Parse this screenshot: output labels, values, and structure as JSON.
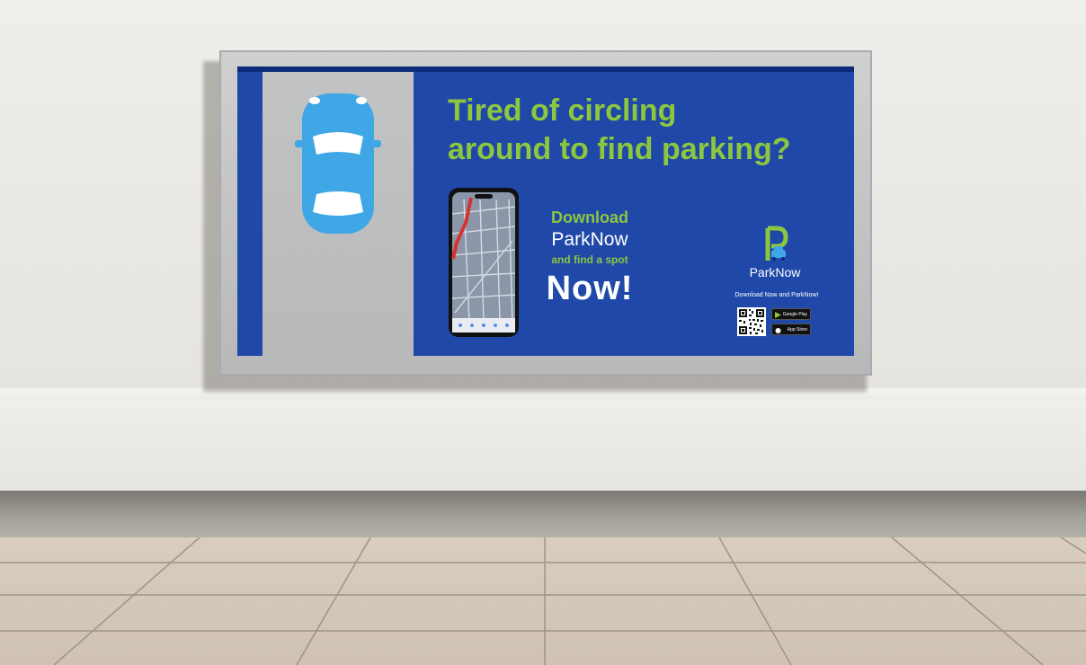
{
  "billboard": {
    "headline_line1": "Tired of circling",
    "headline_line2": "around to find parking?",
    "cta_download": "Download",
    "cta_brand": "ParkNow",
    "cta_find": "and find a spot",
    "cta_now": "Now!",
    "brand_name": "ParkNow",
    "brand_tagline": "Download Now and ParkNow!",
    "google_play_label": "Google Play",
    "app_store_label": "App Store"
  },
  "icons": [
    "car-icon",
    "phone-map-icon",
    "parknow-logo-icon",
    "qr-code-icon",
    "google-play-icon",
    "apple-icon"
  ],
  "colors": {
    "poster_blue": "#1f48a8",
    "accent_green": "#8dc63f",
    "car_blue": "#3fa7e6",
    "parking_gray": "#bdbebf"
  }
}
